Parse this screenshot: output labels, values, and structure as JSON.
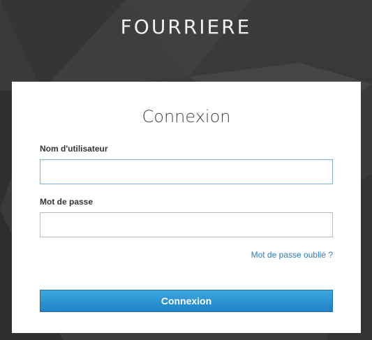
{
  "brand": {
    "title": "FOURRIERE"
  },
  "login": {
    "title": "Connexion",
    "username_label": "Nom d'utilisateur",
    "username_value": "",
    "password_label": "Mot de passe",
    "password_value": "",
    "forgot_link": "Mot de passe oublié ?",
    "submit_label": "Connexion"
  },
  "colors": {
    "background": "#3b3b3b",
    "card": "#ffffff",
    "accent": "#1f82c7",
    "link": "#2a7bbd"
  }
}
